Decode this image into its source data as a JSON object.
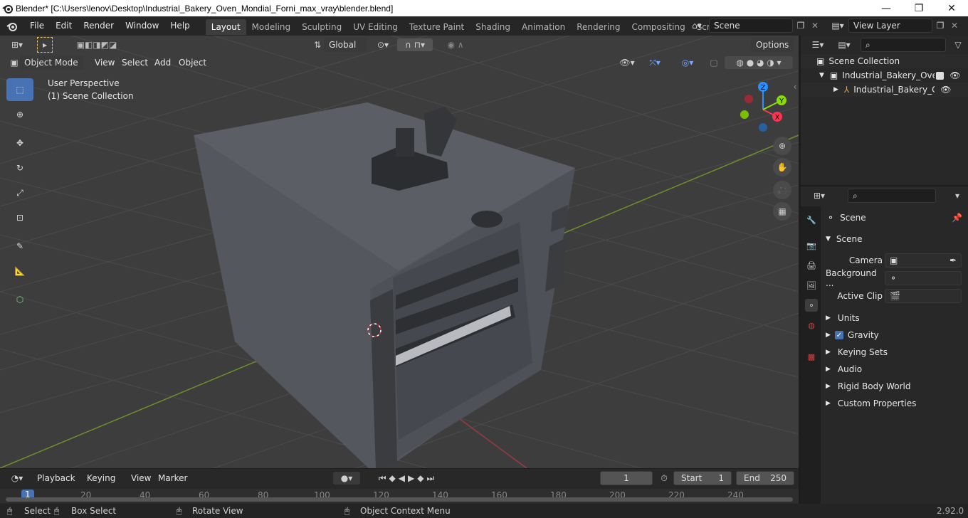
{
  "window": {
    "title": "Blender* [C:\\Users\\lenov\\Desktop\\Industrial_Bakery_Oven_Mondial_Forni_max_vray\\blender.blend]",
    "minimize": "—",
    "maximize": "❐",
    "close": "✕"
  },
  "menu": [
    "File",
    "Edit",
    "Render",
    "Window",
    "Help"
  ],
  "workspaces": [
    "Layout",
    "Modeling",
    "Sculpting",
    "UV Editing",
    "Texture Paint",
    "Shading",
    "Animation",
    "Rendering",
    "Compositing",
    "Scripting"
  ],
  "scene_selector": {
    "label": "Scene"
  },
  "view_layer_selector": {
    "label": "View Layer"
  },
  "viewport_header": {
    "transform_orientation": "Global",
    "options": "Options",
    "mode": "Object Mode",
    "menus": [
      "View",
      "Select",
      "Add",
      "Object"
    ]
  },
  "viewport_overlay": {
    "perspective": "User Perspective",
    "collection": "(1) Scene Collection"
  },
  "gizmo": {
    "x": "X",
    "y": "Y",
    "z": "Z"
  },
  "outliner": {
    "root": "Scene Collection",
    "collection": "Industrial_Bakery_Oven_",
    "object": "Industrial_Bakery_Ov"
  },
  "properties": {
    "context": "Scene",
    "panel_title": "Scene",
    "camera_label": "Camera",
    "background_label": "Background ...",
    "active_clip_label": "Active Clip",
    "subpanels": [
      "Units",
      "Gravity",
      "Keying Sets",
      "Audio",
      "Rigid Body World",
      "Custom Properties"
    ]
  },
  "timeline": {
    "menus": [
      "Playback",
      "Keying",
      "View",
      "Marker"
    ],
    "current_frame": "1",
    "start_label": "Start",
    "start_value": "1",
    "end_label": "End",
    "end_value": "250",
    "ruler_labels": [
      "1",
      "20",
      "40",
      "60",
      "80",
      "100",
      "120",
      "140",
      "160",
      "180",
      "200",
      "220",
      "240"
    ]
  },
  "statusbar": {
    "select": "Select",
    "box_select": "Box Select",
    "rotate_view": "Rotate View",
    "context_menu": "Object Context Menu",
    "version": "2.92.0"
  },
  "colors": {
    "accent": "#4772b3",
    "axis_x": "#ff3352",
    "axis_y": "#8bdc00",
    "axis_z": "#2890ff"
  }
}
